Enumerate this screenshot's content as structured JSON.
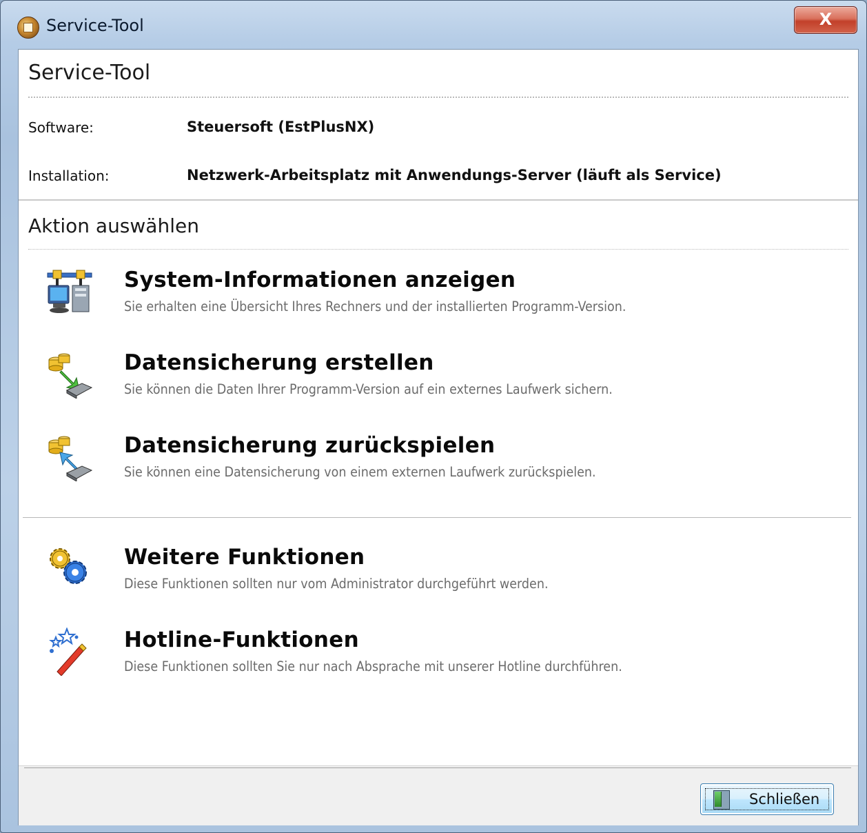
{
  "window": {
    "title": "Service-Tool",
    "close_glyph": "X"
  },
  "header": {
    "title": "Service-Tool",
    "software_label": "Software:",
    "software_value": "Steuersoft (EstPlusNX)",
    "installation_label": "Installation:",
    "installation_value": "Netzwerk-Arbeitsplatz mit Anwendungs-Server (läuft als Service)"
  },
  "actions_section": {
    "title": "Aktion auswählen",
    "items": [
      {
        "title": "System-Informationen anzeigen",
        "description": "Sie erhalten eine Übersicht Ihres Rechners und der installierten Programm-Version.",
        "icon": "system-info-icon"
      },
      {
        "title": "Datensicherung erstellen",
        "description": "Sie können die Daten Ihrer Programm-Version auf ein externes Laufwerk sichern.",
        "icon": "backup-create-icon"
      },
      {
        "title": "Datensicherung zurückspielen",
        "description": "Sie können eine Datensicherung von einem externen Laufwerk zurückspielen.",
        "icon": "backup-restore-icon"
      },
      {
        "title": "Weitere Funktionen",
        "description": "Diese Funktionen sollten nur vom Administrator durchgeführt werden.",
        "icon": "gears-icon"
      },
      {
        "title": "Hotline-Funktionen",
        "description": "Diese Funktionen sollten Sie nur nach Absprache mit unserer Hotline durchführen.",
        "icon": "magic-wand-icon"
      }
    ]
  },
  "footer": {
    "close_label": "Schließen",
    "close_icon": "door-exit-icon"
  },
  "colors": {
    "accent_button_border": "#3c7fb1",
    "title_close_red": "#c2402a",
    "description_gray": "#6b6b6b"
  }
}
